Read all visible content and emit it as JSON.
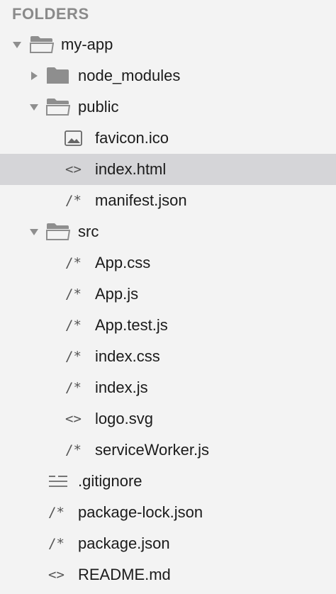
{
  "sidebar": {
    "title": "FOLDERS",
    "glyphs": {
      "code": "<>",
      "comment": "/*"
    },
    "items": [
      {
        "label": "my-app"
      },
      {
        "label": "node_modules"
      },
      {
        "label": "public"
      },
      {
        "label": "favicon.ico"
      },
      {
        "label": "index.html",
        "selected": true
      },
      {
        "label": "manifest.json"
      },
      {
        "label": "src"
      },
      {
        "label": "App.css"
      },
      {
        "label": "App.js"
      },
      {
        "label": "App.test.js"
      },
      {
        "label": "index.css"
      },
      {
        "label": "index.js"
      },
      {
        "label": "logo.svg"
      },
      {
        "label": "serviceWorker.js"
      },
      {
        "label": ".gitignore"
      },
      {
        "label": "package-lock.json"
      },
      {
        "label": "package.json"
      },
      {
        "label": "README.md"
      }
    ]
  },
  "colors": {
    "background": "#f3f3f3",
    "selected_row": "#d5d5d8",
    "header_text": "#8a8a8a",
    "folder_icon": "#8e8e8e",
    "text": "#1b1b1b"
  }
}
